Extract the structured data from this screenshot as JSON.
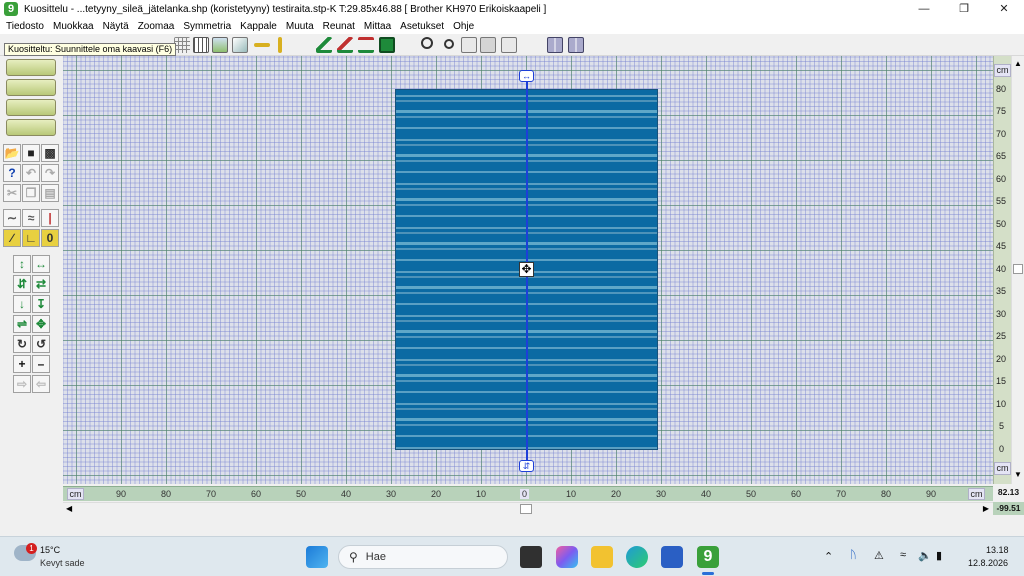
{
  "window": {
    "title": "Kuosittelu - ...tetyyny_sileä_jätelanka.shp (koristetyyny)  testiraita.stp-K     T:29.85x46.88     [ Brother KH970 Erikoiskaapeli ]",
    "minimize_icon": "minimize-icon",
    "maximize_icon": "restore-icon",
    "close_icon": "close-icon"
  },
  "menu": [
    "Tiedosto",
    "Muokkaa",
    "Näytä",
    "Zoomaa",
    "Symmetria",
    "Kappale",
    "Muuta",
    "Reunat",
    "Mittaa",
    "Asetukset",
    "Ohje"
  ],
  "tooltip": "Kuositteltu: Suunnittele oma kaavasi (F6)",
  "colors": {
    "knit_dark": "#0b6aa3",
    "knit_light": "#5a9fc2",
    "center_line": "#1d3fd8",
    "ruler_green": "#b8d2ba"
  },
  "rulers": {
    "unit": "cm",
    "vertical_labels": [
      "80",
      "75",
      "70",
      "65",
      "60",
      "55",
      "50",
      "45",
      "40",
      "35",
      "30",
      "25",
      "20",
      "15",
      "10",
      "5",
      "0"
    ],
    "horizontal_labels": [
      "90",
      "80",
      "70",
      "60",
      "50",
      "40",
      "30",
      "20",
      "10",
      "0",
      "10",
      "20",
      "30",
      "40",
      "50",
      "60",
      "70",
      "80",
      "90"
    ],
    "readout_top": "82.13",
    "readout_bottom": "-99.51"
  },
  "taskbar": {
    "weather_temp": "15°C",
    "weather_desc": "Kevyt sade",
    "weather_badge": "1",
    "search_placeholder": "Hae",
    "time": "13.18",
    "date": "12.8.2026",
    "app_badge": "9"
  }
}
